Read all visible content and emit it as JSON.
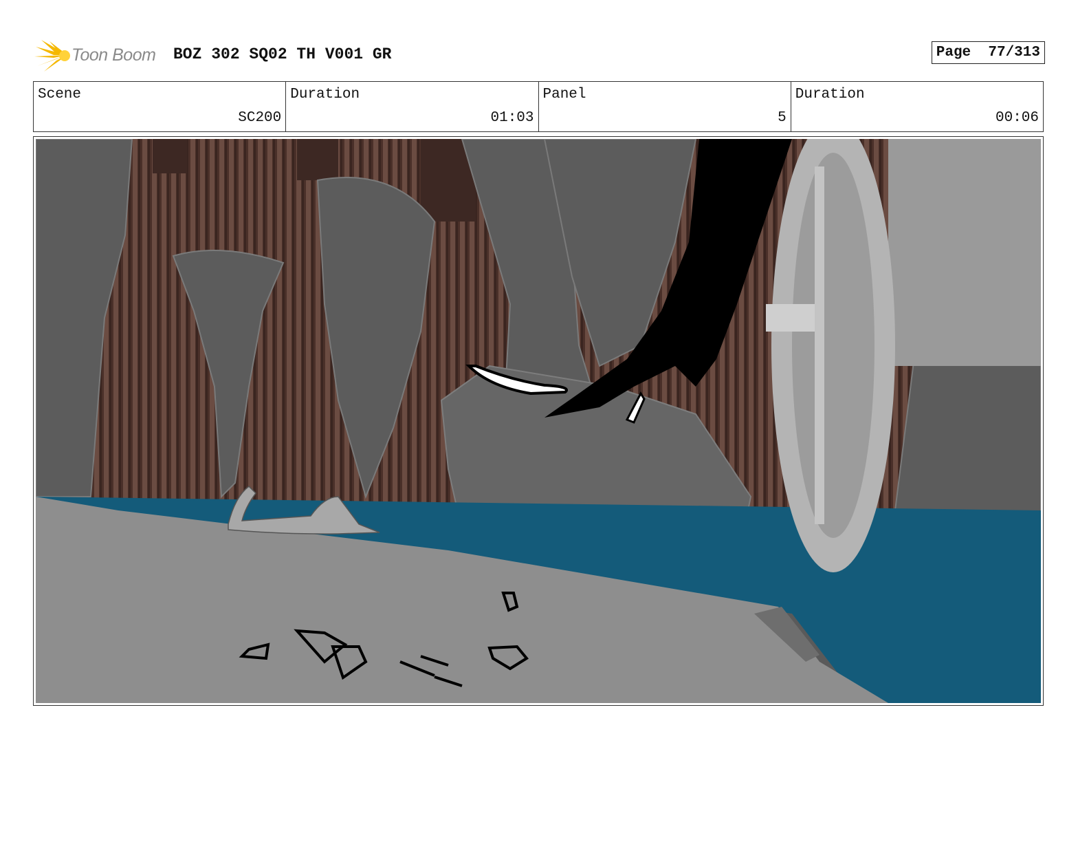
{
  "header": {
    "logo_text": "Toon Boom",
    "title": "BOZ 302 SQ02 TH V001 GR",
    "page_label": "Page",
    "page_value": "77/313"
  },
  "info": [
    {
      "label": "Scene",
      "value": "SC200"
    },
    {
      "label": "Duration",
      "value": "01:03"
    },
    {
      "label": "Panel",
      "value": "5"
    },
    {
      "label": "Duration",
      "value": "00:06"
    }
  ],
  "colors": {
    "water": "#145b7a",
    "rock_gray": "#8e8e8e",
    "column_brown": "#5a3f36",
    "logo_yellow": "#f5b800"
  }
}
